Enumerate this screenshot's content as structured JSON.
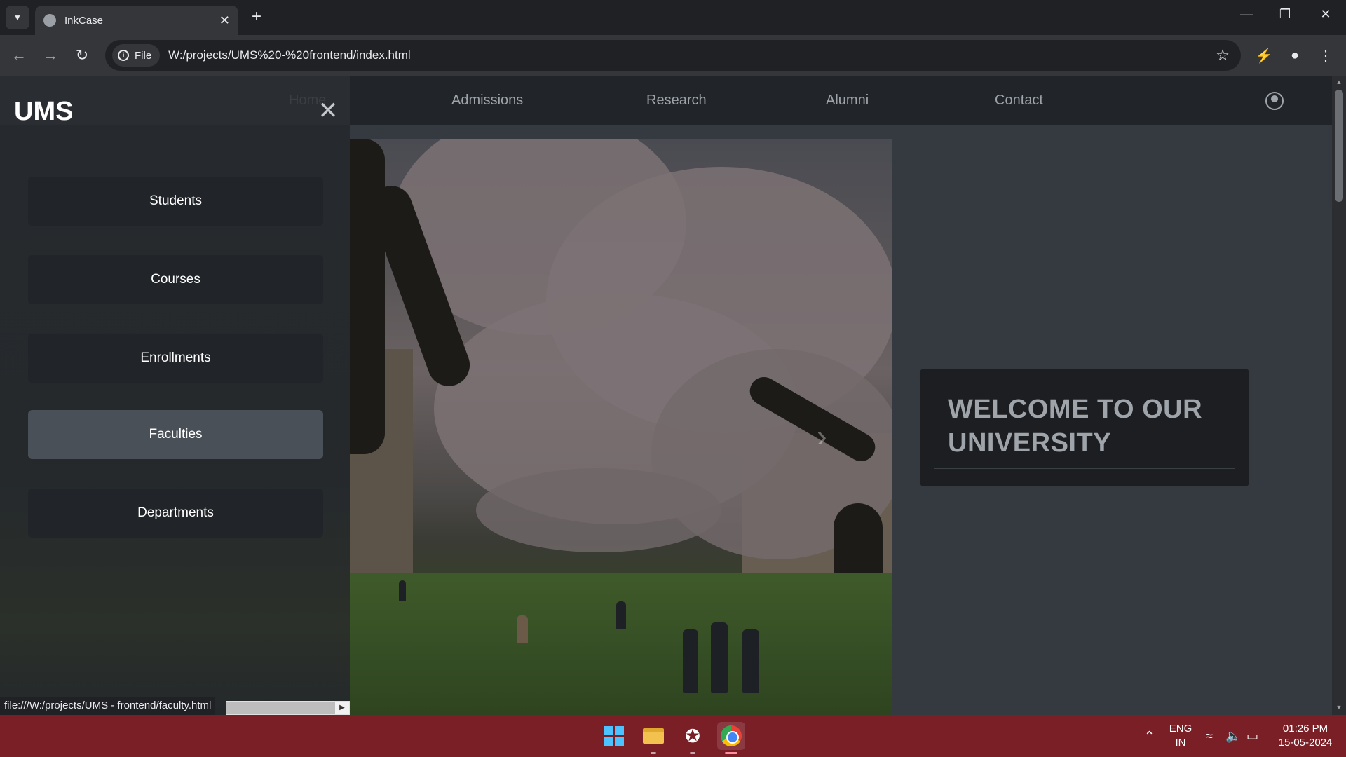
{
  "browser": {
    "tab_title": "InkCase",
    "address_chip": "File",
    "url": "W:/projects/UMS%20-%20frontend/index.html",
    "status_url": "file:///W:/projects/UMS - frontend/faculty.html"
  },
  "site": {
    "nav": [
      {
        "label": "Home"
      },
      {
        "label": "Admissions"
      },
      {
        "label": "Research"
      },
      {
        "label": "Alumni"
      },
      {
        "label": "Contact"
      }
    ],
    "welcome_text": "WELCOME TO OUR UNIVERSITY"
  },
  "offcanvas": {
    "title": "UMS",
    "items": [
      {
        "label": "Students"
      },
      {
        "label": "Courses"
      },
      {
        "label": "Enrollments"
      },
      {
        "label": "Faculties",
        "active": true
      },
      {
        "label": "Departments"
      }
    ]
  },
  "taskbar": {
    "language": "ENG",
    "region": "IN",
    "time": "01:26 PM",
    "date": "15-05-2024"
  },
  "colors": {
    "navbar": "#212529",
    "page_bg": "#343a40",
    "offcanvas_active": "#495057",
    "taskbar": "#7a1f26"
  }
}
